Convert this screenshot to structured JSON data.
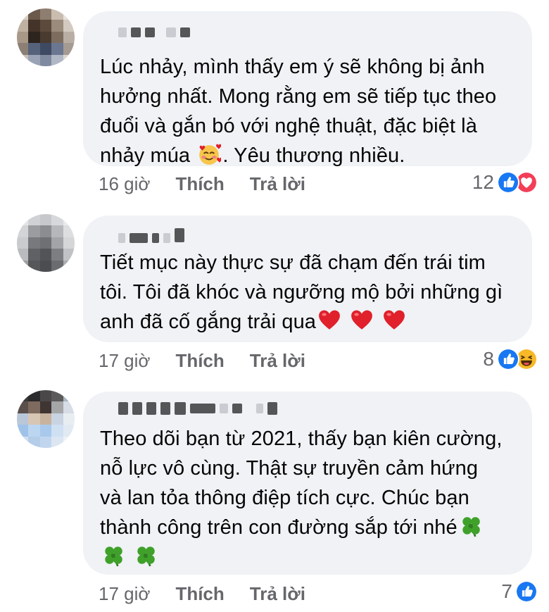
{
  "comments": [
    {
      "text_lines": [
        "Lúc nhảy, mình thấy em ý sẽ không bị ảnh",
        "hưởng nhất. Mong rằng em sẽ tiếp tục theo",
        "đuổi và gắn bó với nghệ thuật, đặc biệt là",
        "nhảy múa",
        ". Yêu thương nhiều."
      ],
      "time": "16 giờ",
      "like_label": "Thích",
      "reply_label": "Trả lời",
      "reaction_count": "12",
      "reactions": [
        "like-icon",
        "love-icon"
      ],
      "emoji": [
        "smiling-face-with-hearts-icon"
      ]
    },
    {
      "text_lines": [
        "Tiết mục này thực sự đã chạm đến trái tim",
        "tôi. Tôi đã khóc và ngưỡng mộ bởi những gì",
        "anh đã cố gắng trải qua"
      ],
      "time": "17 giờ",
      "like_label": "Thích",
      "reply_label": "Trả lời",
      "reaction_count": "8",
      "reactions": [
        "like-icon",
        "haha-icon"
      ],
      "emoji": [
        "red-heart-icon",
        "red-heart-icon",
        "red-heart-icon"
      ]
    },
    {
      "text_lines": [
        "Theo dõi bạn từ 2021, thấy bạn kiên cường,",
        "nỗ lực vô cùng. Thật sự truyền cảm hứng",
        "và lan tỏa thông điệp tích cực. Chúc bạn",
        "thành công trên con đường sắp tới nhé"
      ],
      "time": "17 giờ",
      "like_label": "Thích",
      "reply_label": "Trả lời",
      "reaction_count": "7",
      "reactions": [
        "like-icon"
      ],
      "emoji": [
        "four-leaf-clover-icon",
        "four-leaf-clover-icon",
        "four-leaf-clover-icon"
      ]
    }
  ],
  "colors": {
    "bubble": "#f0f2f5",
    "meta_text": "#65676b",
    "like_blue": "#1877f2",
    "love_red": "#f33e58",
    "haha_yellow": "#f7b928"
  }
}
